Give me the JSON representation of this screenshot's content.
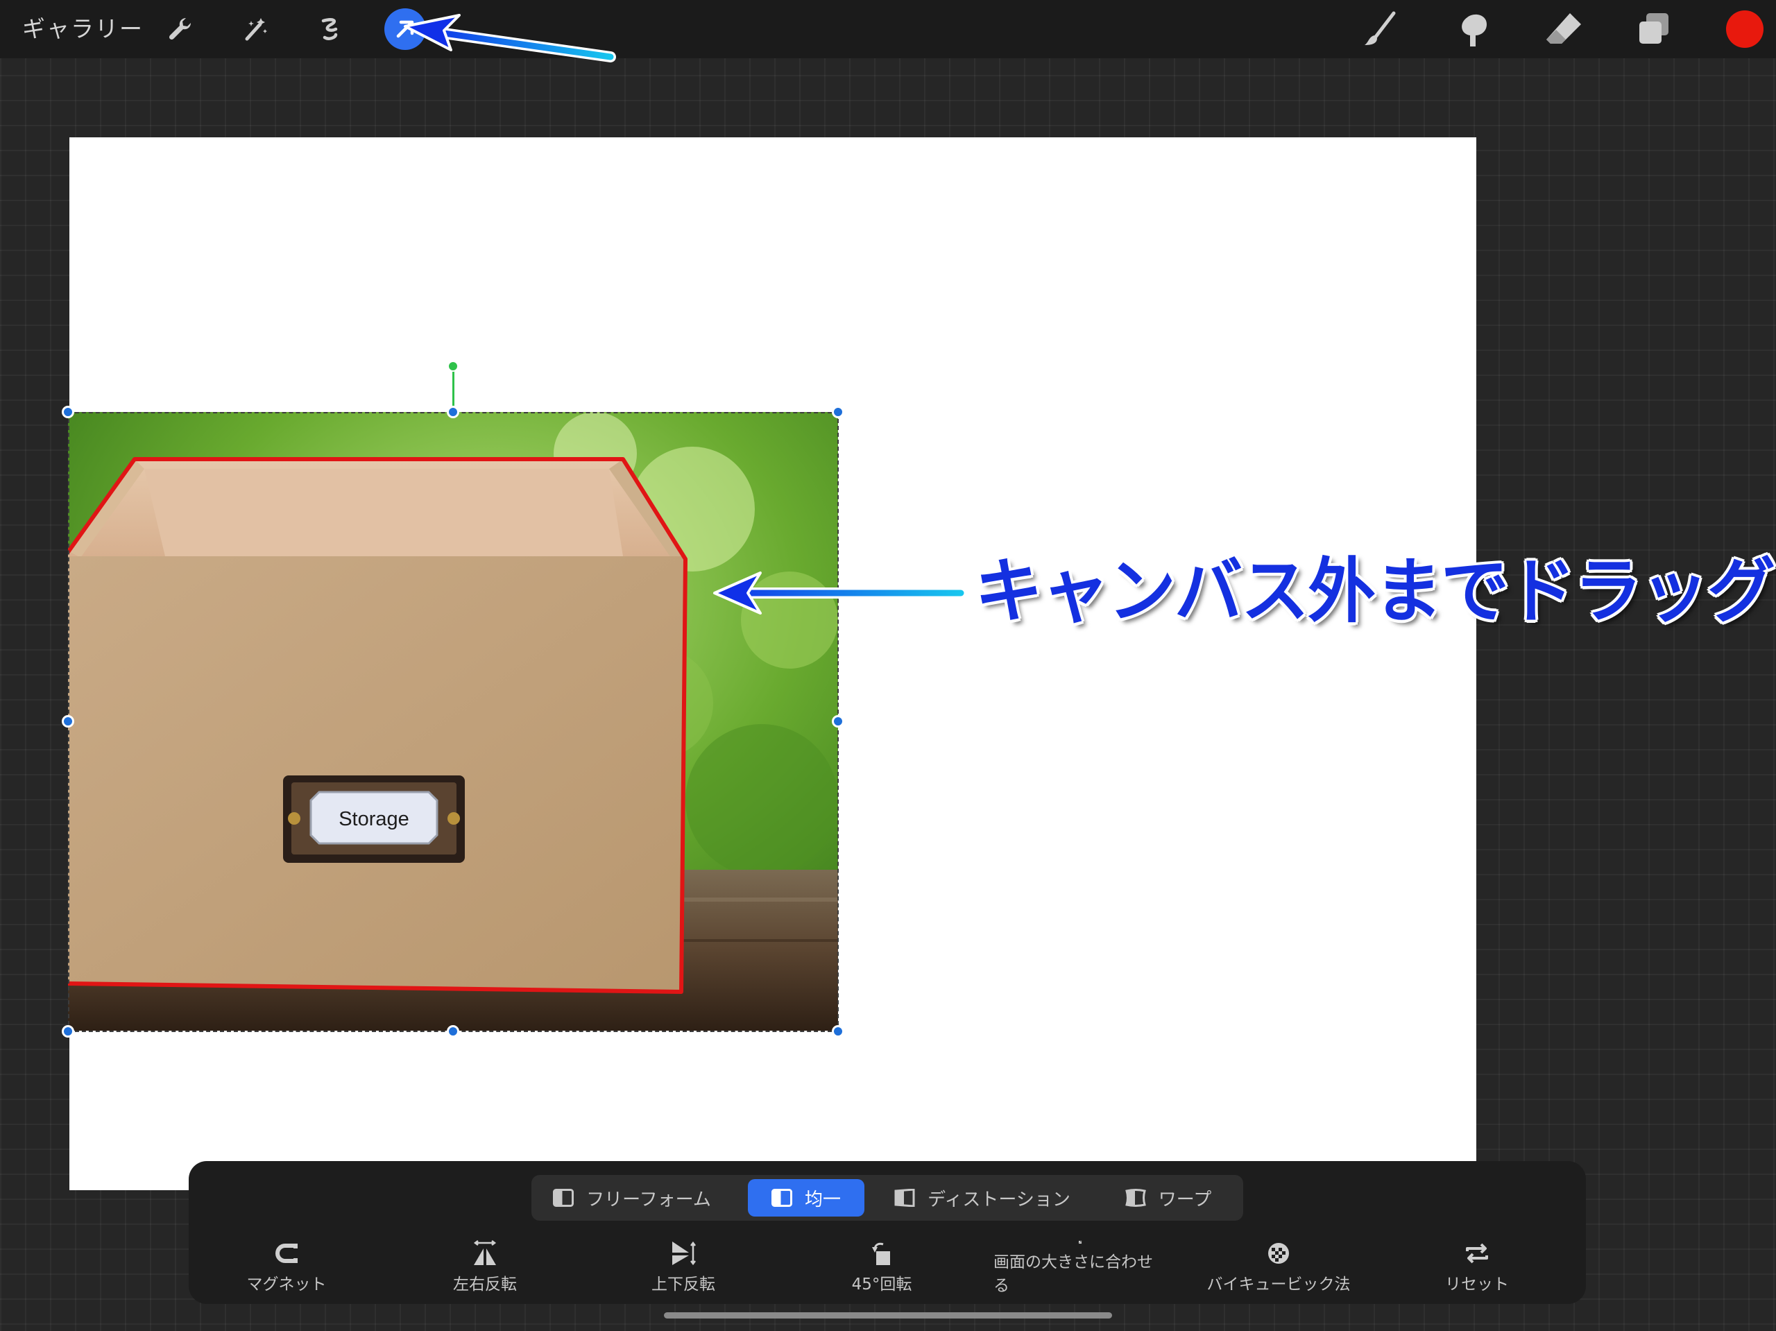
{
  "topbar": {
    "gallery_label": "ギャラリー",
    "tools_left": [
      "wrench-icon",
      "magic-wand-icon",
      "selection-icon",
      "transform-arrow-icon"
    ],
    "tools_right": [
      "brush-icon",
      "smudge-icon",
      "eraser-icon",
      "layers-icon"
    ],
    "active_tool": "transform-arrow-icon",
    "current_color": "#e8190d"
  },
  "canvas": {
    "photo_label": "Storage"
  },
  "annotation": {
    "caption": "キャンバス外までドラッグ",
    "color": "#1430e0"
  },
  "transform_panel": {
    "modes": [
      {
        "label": "フリーフォーム",
        "icon": "freeform-icon"
      },
      {
        "label": "均一",
        "icon": "uniform-icon",
        "active": true
      },
      {
        "label": "ディストーション",
        "icon": "distort-icon"
      },
      {
        "label": "ワープ",
        "icon": "warp-icon"
      }
    ],
    "actions": [
      {
        "label": "マグネット",
        "icon": "magnet-icon"
      },
      {
        "label": "左右反転",
        "icon": "flip-horizontal-icon"
      },
      {
        "label": "上下反転",
        "icon": "flip-vertical-icon"
      },
      {
        "label": "45°回転",
        "icon": "rotate-45-icon"
      },
      {
        "label": "画面の大きさに合わせる",
        "icon": "fit-to-screen-icon"
      },
      {
        "label": "バイキュービック法",
        "icon": "bicubic-icon"
      },
      {
        "label": "リセット",
        "icon": "reset-icon"
      }
    ]
  }
}
